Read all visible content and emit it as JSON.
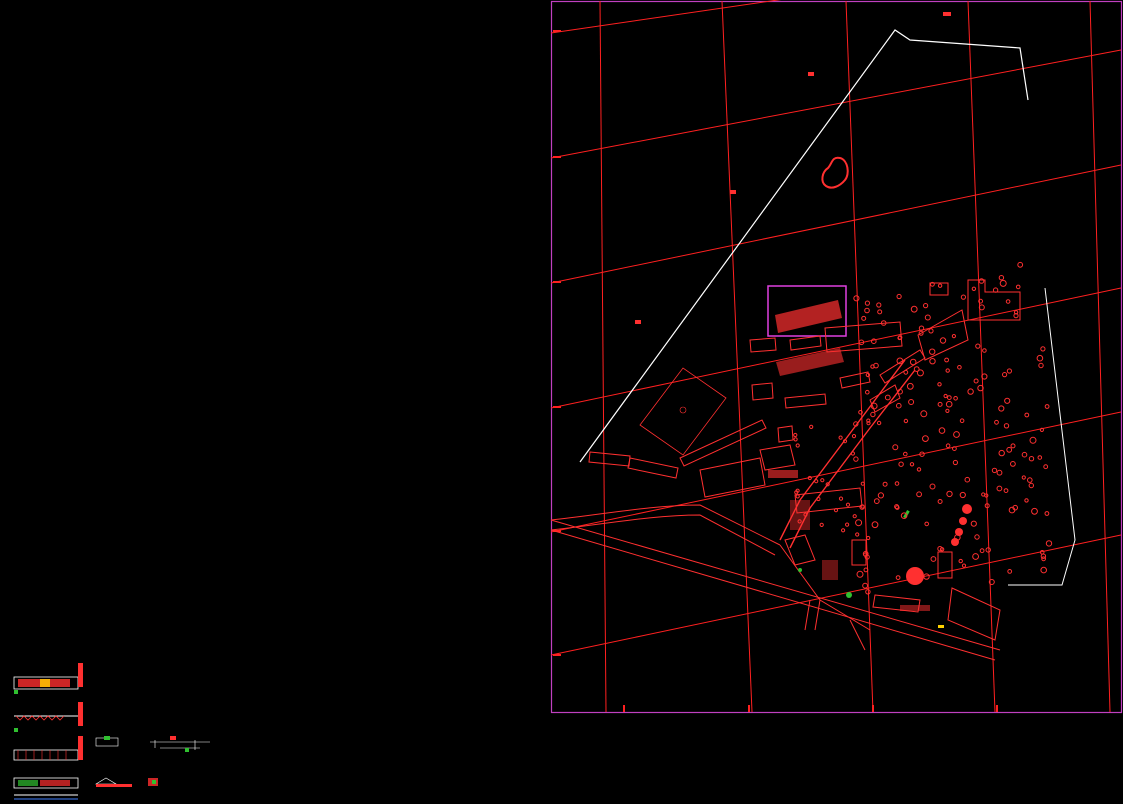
{
  "drawing": {
    "background": "#000000",
    "colors": {
      "grid": "#ff2020",
      "site": "#ff3030",
      "outline": "#ffffff",
      "frame": "#c040c0",
      "highlight": "#e040e0",
      "vegetation": "#30c030",
      "accent": "#ffd000"
    }
  }
}
